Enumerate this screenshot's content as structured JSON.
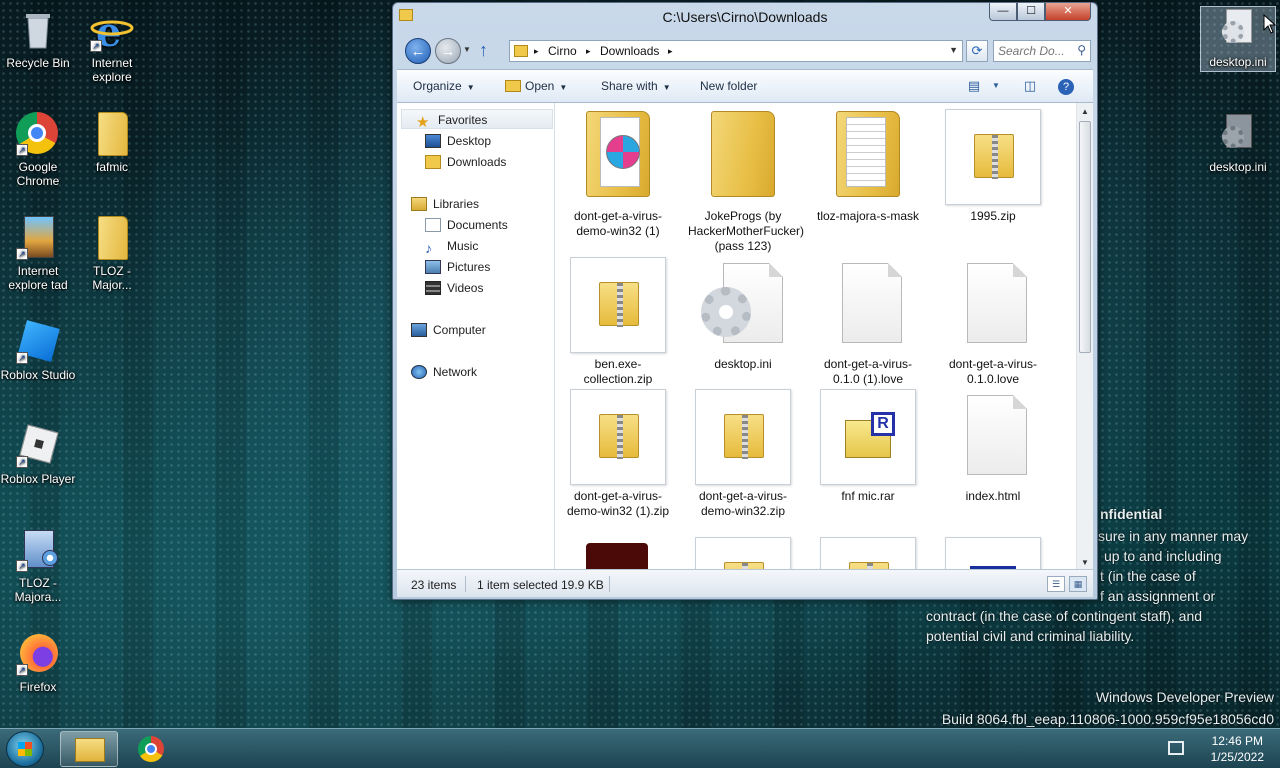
{
  "desktop": {
    "icons_left": [
      {
        "label": "Recycle Bin"
      },
      {
        "label": "Internet explore"
      },
      {
        "label": "Google Chrome"
      },
      {
        "label": "fafmic"
      },
      {
        "label": "Internet explore tad"
      },
      {
        "label": "TLOZ - Major..."
      },
      {
        "label": "Roblox Studio"
      },
      {
        "label": "Roblox Player"
      },
      {
        "label": "TLOZ - Majora..."
      },
      {
        "label": "Firefox"
      }
    ],
    "icons_right": [
      {
        "label": "desktop.ini",
        "selected": true
      },
      {
        "label": "desktop.ini",
        "selected": false
      }
    ],
    "watermark": {
      "heading": "nfidential",
      "lines": [
        "sure in any manner may",
        "up to and including",
        "t (in the case of",
        "f an assignment or",
        "contract (in the case of contingent staff), and",
        "potential civil and criminal liability."
      ],
      "version_line1": "Windows Developer Preview",
      "version_line2": "Build 8064.fbl_eeap.110806-1000.959cf95e18056cd0"
    }
  },
  "explorer": {
    "title": "C:\\Users\\Cirno\\Downloads",
    "window_buttons": {
      "minimize": "—",
      "maximize": "☐",
      "close": "✕"
    },
    "address": {
      "crumbs": [
        "Cirno",
        "Downloads"
      ],
      "separator": "▸"
    },
    "search_placeholder": "Search Do...",
    "toolbar": {
      "organize": "Organize",
      "open": "Open",
      "share_with": "Share with",
      "new_folder": "New folder"
    },
    "nav": {
      "favorites": "Favorites",
      "desktop": "Desktop",
      "downloads": "Downloads",
      "libraries": "Libraries",
      "documents": "Documents",
      "music": "Music",
      "pictures": "Pictures",
      "videos": "Videos",
      "computer": "Computer",
      "network": "Network"
    },
    "files": [
      {
        "name": "dont-get-a-virus-demo-win32 (1)",
        "kind": "folder-disc"
      },
      {
        "name": "JokeProgs (by HackerMotherFucker) (pass 123)",
        "kind": "folder"
      },
      {
        "name": "tloz-majora-s-mask",
        "kind": "folder-docs"
      },
      {
        "name": "1995.zip",
        "kind": "zip"
      },
      {
        "name": "ben.exe-collection.zip",
        "kind": "zip"
      },
      {
        "name": "desktop.ini",
        "kind": "ini"
      },
      {
        "name": "dont-get-a-virus-0.1.0 (1).love",
        "kind": "blank"
      },
      {
        "name": "dont-get-a-virus-0.1.0.love",
        "kind": "blank"
      },
      {
        "name": "dont-get-a-virus-demo-win32 (1).zip",
        "kind": "zip"
      },
      {
        "name": "dont-get-a-virus-demo-win32.zip",
        "kind": "zip"
      },
      {
        "name": "fnf mic.rar",
        "kind": "rar"
      },
      {
        "name": "index.html",
        "kind": "blank"
      }
    ],
    "status": {
      "count": "23 items",
      "selected": "1 item selected",
      "size": "19.9 KB"
    }
  },
  "taskbar": {
    "time": "12:46 PM",
    "date": "1/25/2022"
  }
}
